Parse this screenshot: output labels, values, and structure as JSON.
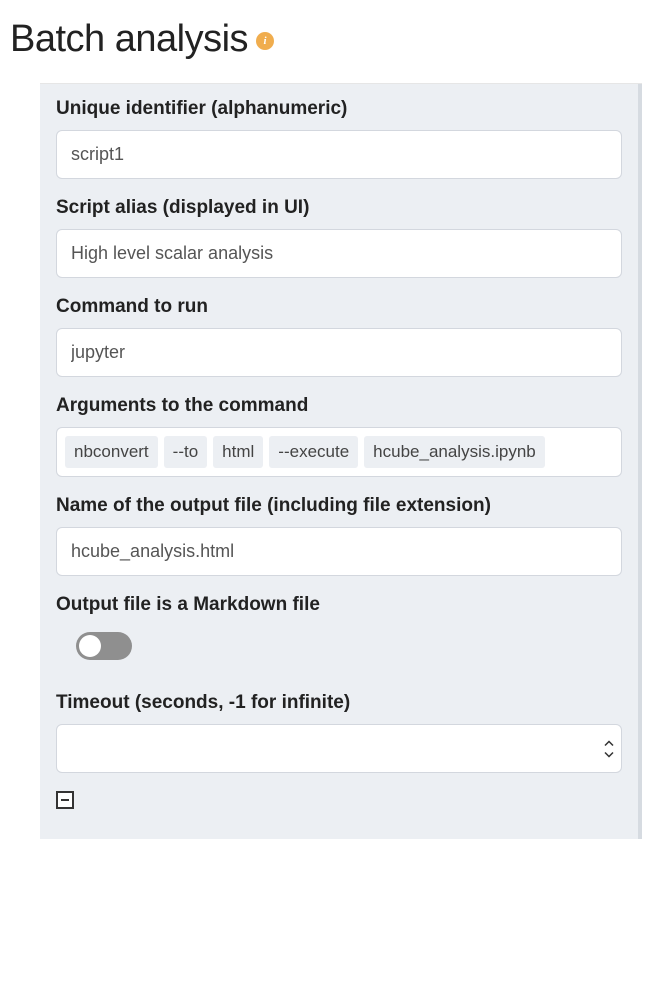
{
  "header": {
    "title": "Batch analysis"
  },
  "form": {
    "identifier": {
      "label": "Unique identifier (alphanumeric)",
      "value": "script1"
    },
    "alias": {
      "label": "Script alias (displayed in UI)",
      "value": "High level scalar analysis"
    },
    "command": {
      "label": "Command to run",
      "value": "jupyter"
    },
    "arguments": {
      "label": "Arguments to the command",
      "tags": [
        "nbconvert",
        "--to",
        "html",
        "--execute",
        "hcube_analysis.ipynb"
      ]
    },
    "output_name": {
      "label": "Name of the output file (including file extension)",
      "value": "hcube_analysis.html"
    },
    "markdown_toggle": {
      "label": "Output file is a Markdown file",
      "value": false
    },
    "timeout": {
      "label": "Timeout (seconds, -1 for infinite)",
      "value": ""
    }
  }
}
